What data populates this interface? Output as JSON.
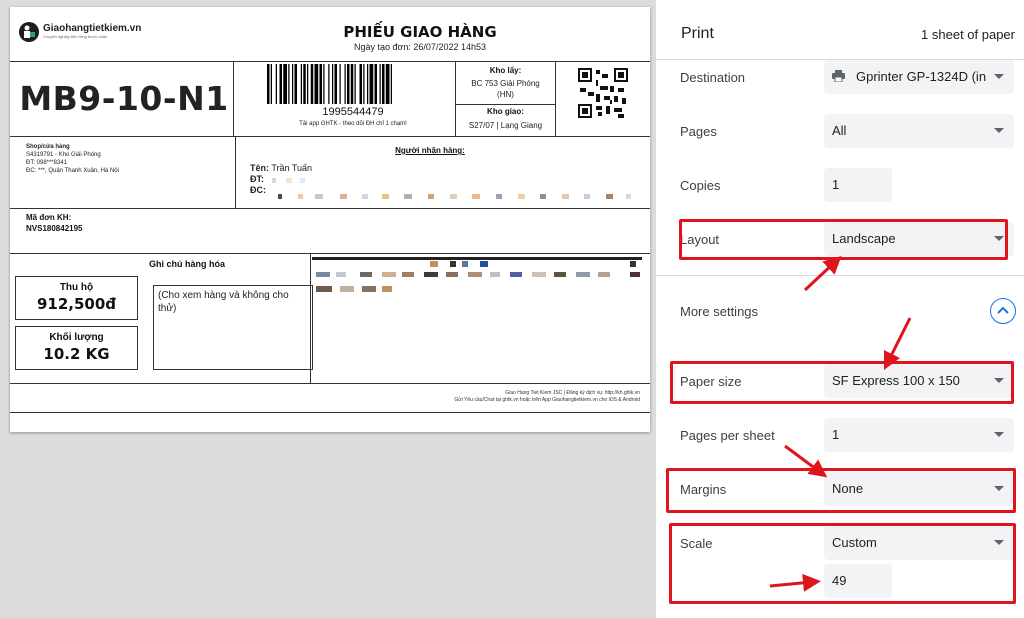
{
  "label": {
    "brand": {
      "name": "Giaohangtietkiem.vn",
      "tagline": "Chuyên nghiệp tiến từng bước chân"
    },
    "title": "PHIẾU GIAO HÀNG",
    "created_date": "Ngày tạo đơn: 26/07/2022 14h53",
    "route_code": "MB9-10-N1",
    "tracking_number": "1995544479",
    "barcode_note": "Tải app GHTK - theo dõi ĐH chỉ 1 chạm!",
    "pickup_warehouse": {
      "label": "Kho lấy:",
      "value_line1": "BC 753 Giải Phóng",
      "value_line2": "(HN)"
    },
    "delivery_warehouse": {
      "label": "Kho giao:",
      "value": "S27/07 | Lạng Giang"
    },
    "shop": {
      "header": "Shop/cửa hàng",
      "line1": "S4319791 - Kho Giải Phóng",
      "line2": "ĐT: 098***8341",
      "line3": "ĐC: ***, Quận Thanh Xuân, Hà Nội"
    },
    "receiver": {
      "title": "Người nhận hàng:",
      "name_label": "Tên:",
      "name": "Trần Tuấn",
      "phone_label": "ĐT:",
      "address_label": "ĐC:"
    },
    "order_code": {
      "label": "Mã đơn KH:",
      "value": "NVS180842195"
    },
    "goods_note_title": "Ghi chú hàng hóa",
    "goods_note": "(Cho xem hàng và không cho thử)",
    "cod": {
      "label": "Thu hộ",
      "value": "912,500đ"
    },
    "weight": {
      "label": "Khối lượng",
      "value": "10.2 KG"
    },
    "footer_line1": "Giao Hang Tiet Kiem JSC | Đăng ký dịch vụ: http://kh.ghtk.vn",
    "footer_line2": "Gửi Yêu cầu/Chat tại ghtk.vn hoặc trên App Giaohangtietkiem.vn cho iOS & Android"
  },
  "print_panel": {
    "title": "Print",
    "sheet_count": "1 sheet of paper",
    "destination": {
      "label": "Destination",
      "value": "Gprinter GP-1324D (in"
    },
    "pages": {
      "label": "Pages",
      "value": "All"
    },
    "copies": {
      "label": "Copies",
      "value": "1"
    },
    "layout": {
      "label": "Layout",
      "value": "Landscape"
    },
    "more_settings": {
      "label": "More settings"
    },
    "paper_size": {
      "label": "Paper size",
      "value": "SF Express 100 x 150"
    },
    "pages_per_sheet": {
      "label": "Pages per sheet",
      "value": "1"
    },
    "margins": {
      "label": "Margins",
      "value": "None"
    },
    "scale": {
      "label": "Scale",
      "value": "Custom",
      "custom_value": "49"
    }
  },
  "colors": {
    "highlight": "#e0141c",
    "accent": "#1a73e8",
    "field_bg": "#f1f3f4"
  },
  "icons": [
    "printer-icon",
    "chevron-up-icon",
    "chevron-down-icon",
    "qr-code-icon",
    "barcode-icon",
    "arrow-icon"
  ]
}
